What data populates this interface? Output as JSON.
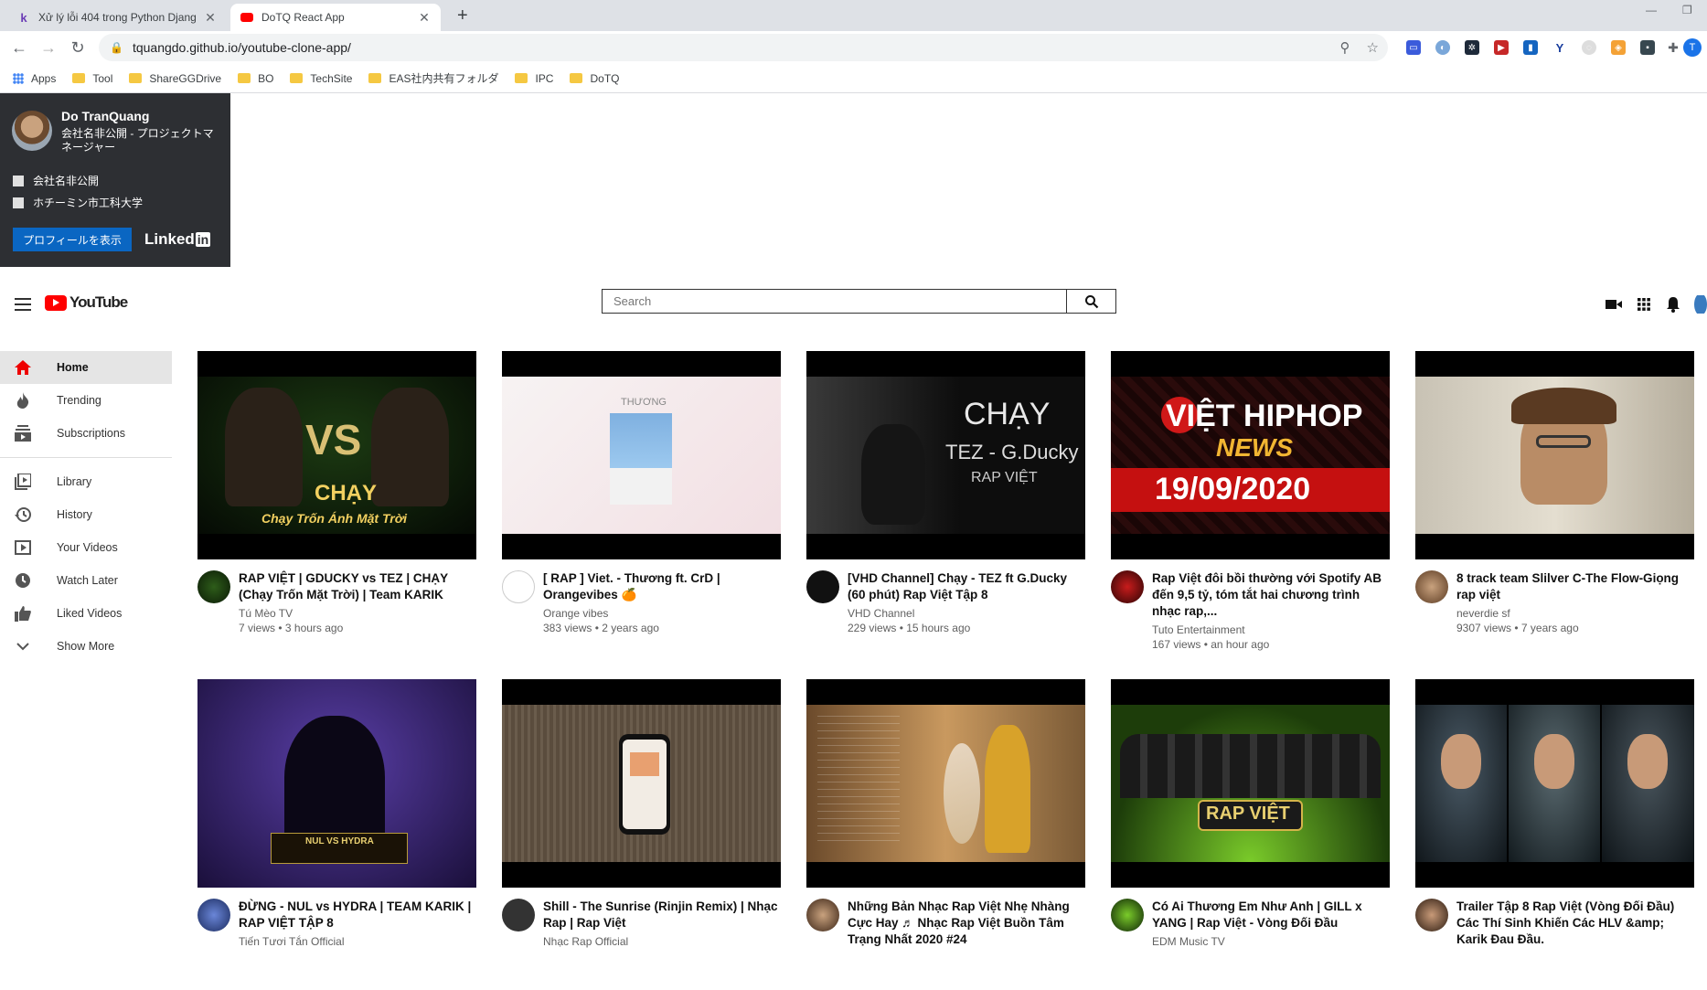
{
  "browser": {
    "tabs": [
      {
        "title": "Xử lý lỗi 404 trong Python Djang",
        "active": false
      },
      {
        "title": "DoTQ React App",
        "active": true
      }
    ],
    "url": "tquangdo.github.io/youtube-clone-app/",
    "profile_initial": "T",
    "bookmarks": [
      "Apps",
      "Tool",
      "ShareGGDrive",
      "BO",
      "TechSite",
      "EAS社内共有フォルダ",
      "IPC",
      "DoTQ"
    ]
  },
  "linkedin": {
    "name": "Do TranQuang",
    "title": "会社名非公開 - プロジェクトマネージャー",
    "company": "会社名非公開",
    "school": "ホチーミン市工科大学",
    "button": "プロフィールを表示",
    "logo_text": "Linked",
    "logo_in": "in"
  },
  "youtube": {
    "logo": "YouTube",
    "search_placeholder": "Search",
    "sidebar": [
      {
        "label": "Home",
        "icon": "home-icon",
        "active": true
      },
      {
        "label": "Trending",
        "icon": "trending-icon"
      },
      {
        "label": "Subscriptions",
        "icon": "subscriptions-icon"
      },
      {
        "label": "Library",
        "icon": "library-icon"
      },
      {
        "label": "History",
        "icon": "history-icon"
      },
      {
        "label": "Your Videos",
        "icon": "your-videos-icon"
      },
      {
        "label": "Watch Later",
        "icon": "watch-later-icon"
      },
      {
        "label": "Liked Videos",
        "icon": "liked-videos-icon"
      },
      {
        "label": "Show More",
        "icon": "chevron-down-icon"
      }
    ],
    "videos": [
      {
        "title": "RAP VIỆT | GDUCKY vs TEZ | CHẠY (Chạy Trốn Mặt Trời) | Team KARIK",
        "channel": "Tú Mèo TV",
        "stats": "7 views • 3 hours ago",
        "thumb_text": "CHẠY"
      },
      {
        "title": "[ RAP ] Viet. - Thương ft. CrD | Orangevibes 🍊",
        "channel": "Orange vibes",
        "stats": "383 views • 2 years ago",
        "thumb_text": "THƯƠNG"
      },
      {
        "title": "[VHD Channel] Chạy - TEZ ft G.Ducky (60 phút) Rap Việt Tập 8",
        "channel": "VHD Channel",
        "stats": "229 views • 15 hours ago",
        "thumb_text": "CHẠY"
      },
      {
        "title": "Rap Việt đôi bồi thường với Spotify AB đến 9,5 tỷ, tóm tắt hai chương trình nhạc rap,...",
        "channel": "Tuto Entertainment",
        "stats": "167 views • an hour ago",
        "thumb_text": "19/09/2020"
      },
      {
        "title": "8 track team Slilver C-The Flow-Giọng rap việt",
        "channel": "neverdie sf",
        "stats": "9307 views • 7 years ago",
        "thumb_text": ""
      },
      {
        "title": "ĐỪNG - NUL vs HYDRA | TEAM KARIK | RAP VIỆT TẬP 8",
        "channel": "Tiến Tươi Tắn Official",
        "stats": "",
        "thumb_text": "NUL VS HYDRA"
      },
      {
        "title": "Shill - The Sunrise (Rinjin Remix) | Nhạc Rap | Rap Việt",
        "channel": "Nhạc Rap Official",
        "stats": "",
        "thumb_text": ""
      },
      {
        "title": "Những Bản Nhạc Rap Việt Nhẹ Nhàng Cực Hay ♬ Nhạc Rap Việt Buồn Tâm Trạng Nhất 2020 #24",
        "channel": "",
        "stats": "",
        "thumb_text": ""
      },
      {
        "title": "Có Ai Thương Em Như Anh | GILL x YANG | Rap Việt - Vòng Đối Đầu",
        "channel": "EDM Music TV",
        "stats": "",
        "thumb_text": "RAP VIỆT"
      },
      {
        "title": "Trailer Tập 8 Rap Việt (Vòng Đối Đầu) Các Thí Sinh Khiến Các HLV &amp; Karik Đau Đầu.",
        "channel": "",
        "stats": "",
        "thumb_text": ""
      }
    ]
  }
}
